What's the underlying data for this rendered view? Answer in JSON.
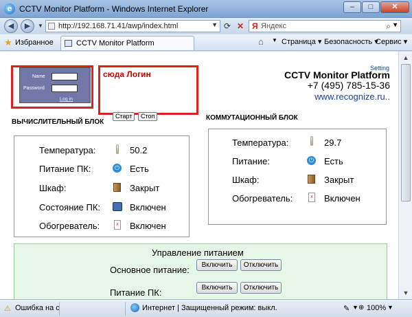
{
  "window": {
    "title": "CCTV Monitor Platform - Windows Internet Explorer",
    "minimize": "–",
    "maximize": "□",
    "close": "✕"
  },
  "address": {
    "url": "http://192.168.71.41/awp/index.html",
    "search_placeholder": "Яндекс",
    "search_engine_letter": "Я"
  },
  "favorites": {
    "label": "Избранное",
    "tab_title": "CCTV Monitor Platform"
  },
  "commands": {
    "page": "Страница ▾",
    "security": "Безопасность ▾",
    "service": "Сервис ▾"
  },
  "login": {
    "name_label": "Name",
    "password_label": "Password",
    "login_link": "Log in",
    "note": "сюда Логин"
  },
  "controls": {
    "start": "Старт",
    "stop": "Стоп"
  },
  "brand": {
    "setting": "Setting",
    "title": "CCTV Monitor Platform",
    "phone": "+7 (495) 785-15-36",
    "site": "www.recognize.ru.."
  },
  "compute_block": {
    "title": "ВЫЧИСЛИТЕЛЬНЫЙ БЛОК",
    "rows": [
      {
        "label": "Температура:",
        "value": "50.2",
        "icon": "thermometer-icon"
      },
      {
        "label": "Питание ПК:",
        "value": "Есть",
        "icon": "power-icon"
      },
      {
        "label": "Шкаф:",
        "value": "Закрыт",
        "icon": "cabinet-icon"
      },
      {
        "label": "Состояние ПК:",
        "value": "Включен",
        "icon": "pc-icon"
      },
      {
        "label": "Обогреватель:",
        "value": "Включен",
        "icon": "heater-icon"
      }
    ]
  },
  "switch_block": {
    "title": "КОММУТАЦИОННЫЙ БЛОК",
    "rows": [
      {
        "label": "Температура:",
        "value": "29.7",
        "icon": "thermometer-icon"
      },
      {
        "label": "Питание:",
        "value": "Есть",
        "icon": "power-icon"
      },
      {
        "label": "Шкаф:",
        "value": "Закрыт",
        "icon": "cabinet-icon"
      },
      {
        "label": "Обогреватель:",
        "value": "Включен",
        "icon": "heater-icon"
      }
    ]
  },
  "power_mgmt": {
    "title": "Управление питанием",
    "main_label": "Основное питание:",
    "pc_label": "Питание ПК:",
    "on": "Включить",
    "off": "Отключить"
  },
  "status": {
    "error": "Ошибка на с",
    "zone": "Интернет | Защищенный режим: выкл.",
    "zoom": "100%"
  }
}
